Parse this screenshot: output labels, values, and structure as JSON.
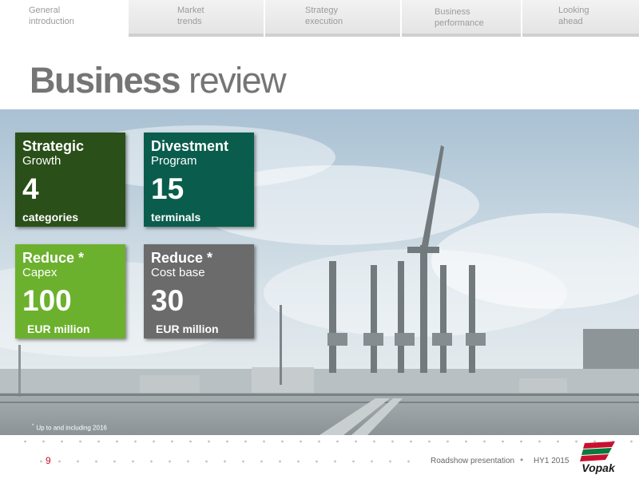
{
  "nav": {
    "tabs": [
      {
        "label": "General\nintroduction"
      },
      {
        "label": "Market\ntrends"
      },
      {
        "label": "Strategy\nexecution"
      },
      {
        "label": "Business\nperformance"
      },
      {
        "label": "Looking\nahead"
      }
    ]
  },
  "slide": {
    "title_bold": "Business",
    "title_light": " review"
  },
  "cards": [
    {
      "title": "Strategic",
      "subtitle": "Growth",
      "number": "4",
      "unit": "categories",
      "color": "#2b4f19"
    },
    {
      "title": "Divestment",
      "subtitle": "Program",
      "number": "15",
      "unit": "terminals",
      "color": "#0a5d4d"
    },
    {
      "title": "Reduce *",
      "subtitle": "Capex",
      "number": "100",
      "unit": "EUR million",
      "color": "#6cb12d"
    },
    {
      "title": "Reduce *",
      "subtitle": "Cost base",
      "number": "30",
      "unit": "EUR million",
      "color": "#6b6b6b"
    }
  ],
  "footnote": {
    "marker": "*",
    "text": "Up to and including 2016"
  },
  "footer": {
    "page": "9",
    "presentation": "Roadshow presentation",
    "separator": "•",
    "period": "HY1 2015",
    "logo_text": "Vopak"
  },
  "colors": {
    "accent_red": "#c8102e",
    "title_gray": "#757575"
  }
}
